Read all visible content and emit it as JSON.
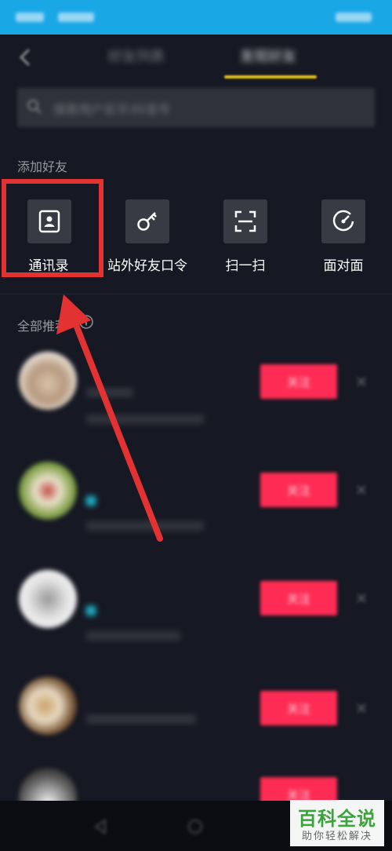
{
  "status_bar": {
    "time": "",
    "carrier": "",
    "battery": ""
  },
  "header": {
    "tabs": [
      {
        "label": "好友列表",
        "active": false
      },
      {
        "label": "发现好友",
        "active": true
      }
    ]
  },
  "search": {
    "placeholder": "搜索用户名字/抖音号"
  },
  "add_friends": {
    "title": "添加好友",
    "options": [
      {
        "label": "通讯录",
        "icon": "contact-card-icon"
      },
      {
        "label": "站外好友口令",
        "icon": "key-icon"
      },
      {
        "label": "扫一扫",
        "icon": "scan-icon"
      },
      {
        "label": "面对面",
        "icon": "radar-icon"
      }
    ]
  },
  "recommend": {
    "title": "全部推荐",
    "users": [
      {
        "name": "",
        "line1": "",
        "line2": "",
        "button": "关注"
      },
      {
        "name": "",
        "line1": "",
        "line2": "",
        "button": "关注"
      },
      {
        "name": "",
        "line1": "",
        "line2": "",
        "button": "关注"
      },
      {
        "name": "",
        "line1": "",
        "line2": "",
        "button": "关注"
      },
      {
        "name": "",
        "line1": "",
        "line2": "",
        "button": "关注"
      }
    ]
  },
  "watermark": {
    "title": "百科全说",
    "subtitle": "助你轻松解决"
  },
  "colors": {
    "background": "#161823",
    "status_bar": "#1aa7e6",
    "accent_yellow": "#e8c21a",
    "follow_red": "#fe2c55",
    "annotation_red": "#e23232",
    "watermark_green": "#3aa33a"
  }
}
